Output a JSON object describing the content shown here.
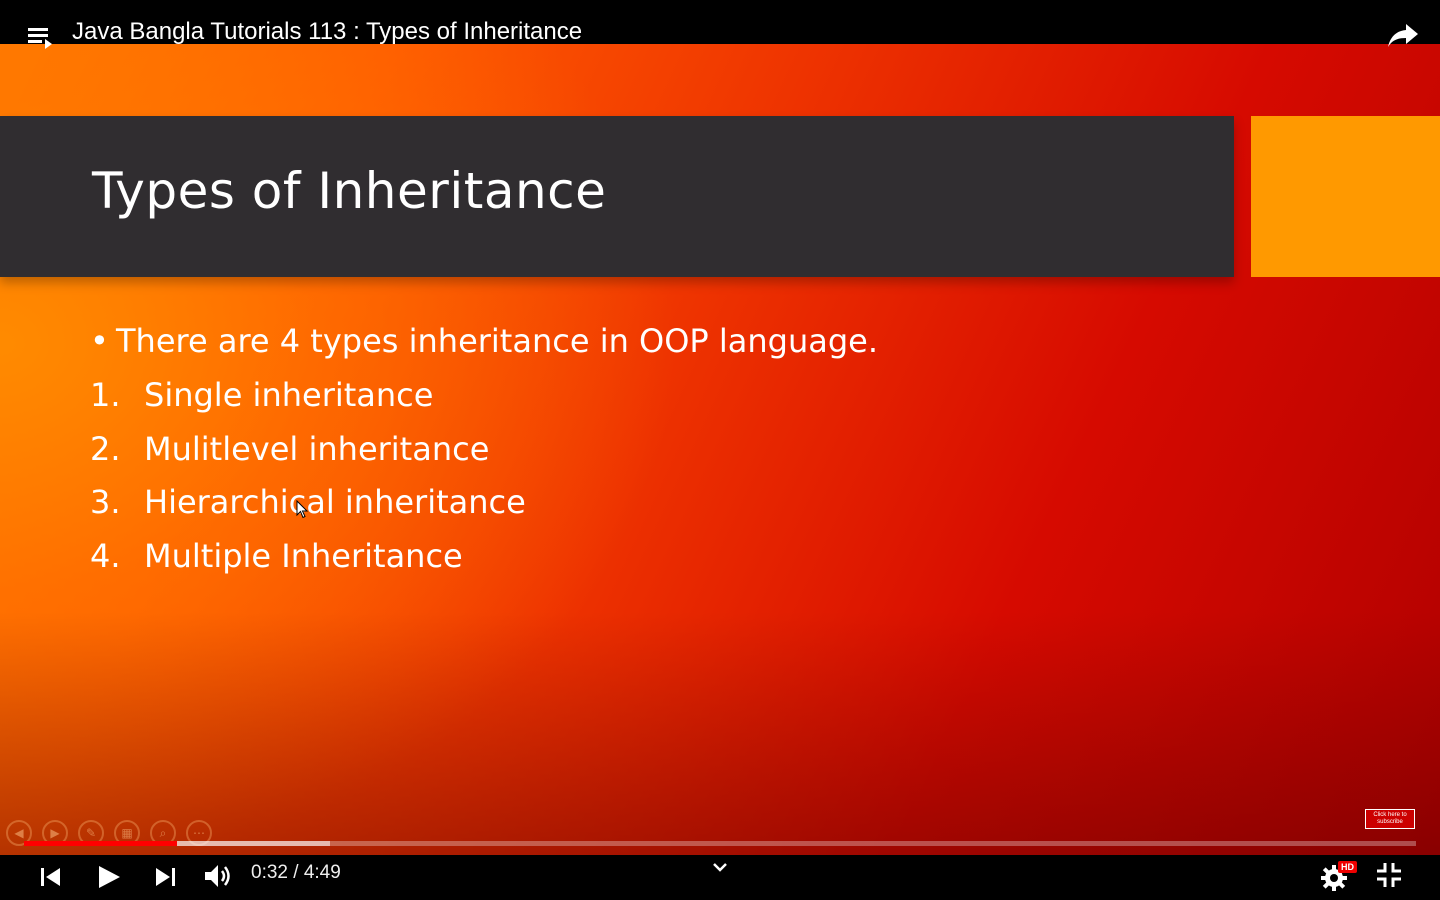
{
  "player": {
    "title": "Java Bangla Tutorials 113 : Types of Inheritance",
    "current_time": "0:32",
    "duration": "4:49",
    "time_text": "0:32 / 4:49",
    "progress_fraction": 0.11,
    "buffered_fraction": 0.22,
    "quality_badge": "HD",
    "subscribe_badge": "Click here to subscribe"
  },
  "slide": {
    "title": "Types of Inheritance",
    "bullet": "There are 4 types inheritance in OOP language.",
    "items": [
      {
        "num": "1.",
        "text": "Single inheritance"
      },
      {
        "num": "2.",
        "text": "Mulitlevel inheritance"
      },
      {
        "num": "3.",
        "text": "Hierarchical inheritance"
      },
      {
        "num": "4.",
        "text": "Multiple Inheritance"
      }
    ]
  },
  "icons": {
    "playlist": "playlist-icon",
    "share": "share-icon",
    "prev": "previous-icon",
    "play": "play-icon",
    "next": "next-icon",
    "volume": "volume-icon",
    "chevron": "chevron-down-icon",
    "settings": "gear-icon",
    "exit_fullscreen": "exit-fullscreen-icon"
  },
  "colors": {
    "progress_played": "#ff0000",
    "title_bar": "#302d30",
    "accent": "#ff9900"
  }
}
